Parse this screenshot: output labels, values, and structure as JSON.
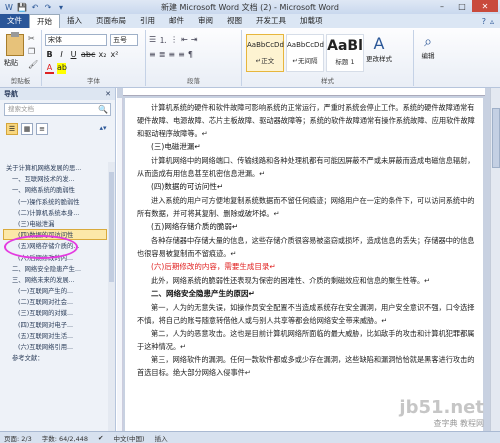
{
  "window": {
    "title": "新建 Microsoft Word 文档 (2) - Microsoft Word",
    "minimize": "–",
    "maximize": "□",
    "close": "✕"
  },
  "quick_access": [
    "W",
    "💾",
    "↶",
    "↷",
    "▾"
  ],
  "ribbon_tabs": [
    "文件",
    "开始",
    "插入",
    "页面布局",
    "引用",
    "邮件",
    "审阅",
    "视图",
    "开发工具",
    "加载项"
  ],
  "ribbon_tabs_right": [
    "?",
    "▵"
  ],
  "ribbon": {
    "clipboard": {
      "paste_label": "粘贴",
      "group_label": "剪贴板"
    },
    "font": {
      "font_name": "宋体",
      "font_size": "五号",
      "format_buttons": [
        "B",
        "I",
        "U",
        "abc",
        "x₂",
        "x²",
        "A"
      ],
      "group_label": "字体"
    },
    "paragraph": {
      "buttons": [
        "≡",
        "≣",
        "≡",
        "≡",
        "¶"
      ],
      "group_label": "段落"
    },
    "styles": {
      "items": [
        {
          "sample": "AaBbCcDd",
          "name": "↵正文"
        },
        {
          "sample": "AaBbCcDd",
          "name": "↵无间隔"
        },
        {
          "sample": "AaBl",
          "name": "标题 1"
        }
      ],
      "change_label": "更改样式",
      "group_label": "样式"
    },
    "editing": {
      "label": "编辑"
    }
  },
  "nav": {
    "title": "导航",
    "close": "✕",
    "search_placeholder": "搜索文档",
    "search_icon": "🔍",
    "items": [
      {
        "text": "关于计算机网络发展的思...",
        "level": 1
      },
      {
        "text": "一、互联网技术的发...",
        "level": 2
      },
      {
        "text": "一、网络系统的脆弱性",
        "level": 2
      },
      {
        "text": "(一)操作系统的脆弱性",
        "level": 3
      },
      {
        "text": "(二)计算机系统本身...",
        "level": 3
      },
      {
        "text": "(三)电磁泄漏",
        "level": 3
      },
      {
        "text": "(四)数据的可访问性",
        "level": 3,
        "highlight": true
      },
      {
        "text": "(五)网络存储介质的...",
        "level": 3
      },
      {
        "text": "(六)后期修改的内...",
        "level": 3
      },
      {
        "text": "二、网络安全隐患产生...",
        "level": 2
      },
      {
        "text": "三、网络未来的发展...",
        "level": 2
      },
      {
        "text": "(一)互联网产生的...",
        "level": 3
      },
      {
        "text": "(二)互联网对社会...",
        "level": 3
      },
      {
        "text": "(三)互联网的对媒...",
        "level": 3
      },
      {
        "text": "(四)互联网对电子...",
        "level": 3
      },
      {
        "text": "(五)互联网对生活...",
        "level": 3
      },
      {
        "text": "(六)互联网络引用...",
        "level": 3
      },
      {
        "text": "参考文献：",
        "level": 2
      }
    ]
  },
  "document": {
    "blocks": [
      {
        "type": "p",
        "text": "计算机系统的硬件和软件故障可影响系统的正常运行，严重时系统会停止工作。系统的硬件故障通常有硬件故障、电源故障、芯片主板故障、驱动器故障等；系统的软件故障通常有操作系统故障、应用软件故障和驱动程序故障等。↵"
      },
      {
        "type": "h",
        "text": "(三)电磁泄漏↵"
      },
      {
        "type": "p",
        "text": "计算机网络中的网络端口、传输线路和各种处理机都有可能因屏蔽不严或未屏蔽而造成电磁信息辐射，从而造成有用信息甚至机密信息泄漏。↵"
      },
      {
        "type": "h",
        "text": "(四)数据的可访问性↵"
      },
      {
        "type": "p",
        "text": "进入系统的用户可方便地复制系统数据而不留任何痕迹；网络用户在一定的条件下，可以访问系统中的所有数据，并可将其复制、删除或破坏掉。↵"
      },
      {
        "type": "h",
        "text": "(五)网络存储介质的脆弱↵"
      },
      {
        "type": "p",
        "text": "各种存储器中存储大量的信息，这些存储介质很容易被盗窃或损坏，造成信息的丢失；存储器中的信息也很容易被复制而不留痕迹。↵"
      },
      {
        "type": "h",
        "red": true,
        "text": "(六)后期修改的内容，需要生成目录↵"
      },
      {
        "type": "p",
        "text": "此外，网络系统的脆弱性还表现为保密的困难性、介质的剩磁效应和信息的聚生性等。↵"
      },
      {
        "type": "h",
        "bold": true,
        "text": "二、网络安全隐患产生的原因↵"
      },
      {
        "type": "p",
        "text": "第一，人为的无意失误，如操作员安全配置不当造成系统存在安全漏洞，用户安全意识不强，口令选择不慎，将自己的账号随意转借他人或与别人共享等都会给网络安全带来威胁。↵"
      },
      {
        "type": "p",
        "text": "第二，人为的恶意攻击。这也是目前计算机网络所面临的最大威胁，比如敌手的攻击和计算机犯罪都属于这种情况。↵"
      },
      {
        "type": "p",
        "text": "第三，网络软件的漏洞。任何一款软件都或多或少存在漏洞，这些缺陷和漏洞恰恰就是黑客进行攻击的首选目标。绝大部分网络入侵事件↵"
      }
    ]
  },
  "watermark": {
    "line1": "jb51.net",
    "line2": "查字典 教程网"
  },
  "status": {
    "page": "页面: 2/3",
    "words": "字数: 64/2,448",
    "lang": "中文(中国)",
    "mode": "插入"
  }
}
